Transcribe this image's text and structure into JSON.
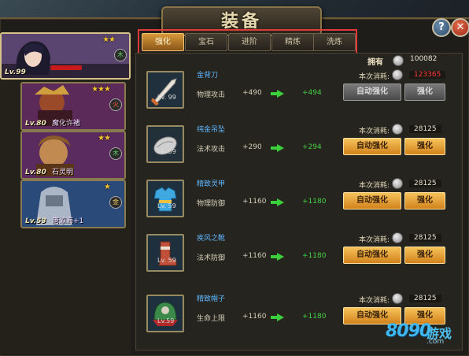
{
  "window": {
    "title": "装备"
  },
  "controls": {
    "help_label": "?",
    "close_label": "✕"
  },
  "heroes": [
    {
      "level": "Lv.99",
      "name": "",
      "stars": "★★",
      "badge": "木",
      "selected": true
    },
    {
      "level": "Lv.80",
      "name": "魔化许褚",
      "stars": "★★★",
      "badge": "火"
    },
    {
      "level": "Lv.80",
      "name": "石灵明",
      "stars": "★★",
      "badge": "木"
    },
    {
      "level": "Lv.53",
      "name": "唐添海+1",
      "stars": "★",
      "badge": "金"
    }
  ],
  "tabs": [
    {
      "label": "强化",
      "active": true
    },
    {
      "label": "宝石"
    },
    {
      "label": "进阶"
    },
    {
      "label": "精炼"
    },
    {
      "label": "洗炼"
    }
  ],
  "owned": {
    "label": "拥有",
    "value": "100082"
  },
  "items": [
    {
      "name": "金背刀",
      "level": "Lv. 99",
      "stat": "物理攻击",
      "current": "+490",
      "next": "+494",
      "cost_label": "本次消耗:",
      "cost": "123365",
      "insufficient": true,
      "auto_label": "自动强化",
      "once_label": "强化",
      "enabled": false,
      "icon": "sword-icon"
    },
    {
      "name": "纯金吊坠",
      "level": "Lv. 59",
      "stat": "法术攻击",
      "current": "+290",
      "next": "+294",
      "cost_label": "本次消耗:",
      "cost": "28125",
      "insufficient": false,
      "auto_label": "自动强化",
      "once_label": "强化",
      "enabled": true,
      "icon": "pendant-icon"
    },
    {
      "name": "精致灵甲",
      "level": "Lv. 59",
      "stat": "物理防御",
      "current": "+1160",
      "next": "+1180",
      "cost_label": "本次消耗:",
      "cost": "28125",
      "insufficient": false,
      "auto_label": "自动强化",
      "once_label": "强化",
      "enabled": true,
      "icon": "armor-icon"
    },
    {
      "name": "疾风之靴",
      "level": "Lv. 59",
      "stat": "法术防御",
      "current": "+1160",
      "next": "+1180",
      "cost_label": "本次消耗:",
      "cost": "28125",
      "insufficient": false,
      "auto_label": "自动强化",
      "once_label": "强化",
      "enabled": true,
      "icon": "boots-icon"
    },
    {
      "name": "精致帽子",
      "level": "Lv.59",
      "stat": "生命上限",
      "current": "+1160",
      "next": "+1180",
      "cost_label": "本次消耗:",
      "cost": "28125",
      "insufficient": false,
      "auto_label": "自动强化",
      "once_label": "强化",
      "enabled": true,
      "icon": "helmet-icon"
    }
  ],
  "watermark": {
    "digits": "8090",
    "text": "游戏",
    "url": ".com"
  }
}
